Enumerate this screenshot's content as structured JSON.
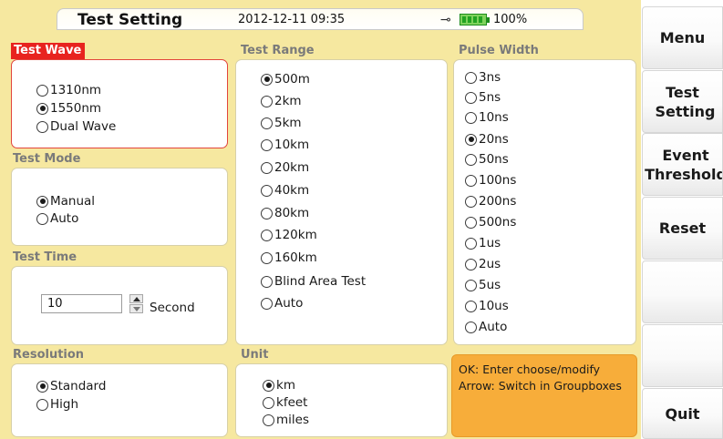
{
  "header": {
    "title": "Test Setting",
    "datetime": "2012-12-11 09:35",
    "battery_percent": "100%",
    "icons": [
      "power-plug-icon",
      "battery-icon"
    ]
  },
  "test_wave": {
    "title": "Test Wave",
    "active": true,
    "options": [
      {
        "label": "1310nm",
        "selected": false
      },
      {
        "label": "1550nm",
        "selected": true
      },
      {
        "label": "Dual Wave",
        "selected": false
      }
    ]
  },
  "test_mode": {
    "title": "Test Mode",
    "options": [
      {
        "label": "Manual",
        "selected": true
      },
      {
        "label": "Auto",
        "selected": false
      }
    ]
  },
  "test_time": {
    "title": "Test Time",
    "value": "10",
    "unit": "Second"
  },
  "resolution": {
    "title": "Resolution",
    "options": [
      {
        "label": "Standard",
        "selected": true
      },
      {
        "label": "High",
        "selected": false
      }
    ]
  },
  "test_range": {
    "title": "Test Range",
    "options": [
      {
        "label": "500m",
        "selected": true
      },
      {
        "label": "2km",
        "selected": false
      },
      {
        "label": "5km",
        "selected": false
      },
      {
        "label": "10km",
        "selected": false
      },
      {
        "label": "20km",
        "selected": false
      },
      {
        "label": "40km",
        "selected": false
      },
      {
        "label": "80km",
        "selected": false
      },
      {
        "label": "120km",
        "selected": false
      },
      {
        "label": "160km",
        "selected": false
      },
      {
        "label": "Blind Area Test",
        "selected": false
      },
      {
        "label": "Auto",
        "selected": false
      }
    ]
  },
  "unit": {
    "title": "Unit",
    "options": [
      {
        "label": "km",
        "selected": true
      },
      {
        "label": "kfeet",
        "selected": false
      },
      {
        "label": "miles",
        "selected": false
      }
    ]
  },
  "pulse_width": {
    "title": "Pulse Width",
    "options": [
      {
        "label": "3ns",
        "selected": false
      },
      {
        "label": "5ns",
        "selected": false
      },
      {
        "label": "10ns",
        "selected": false
      },
      {
        "label": "20ns",
        "selected": true
      },
      {
        "label": "50ns",
        "selected": false
      },
      {
        "label": "100ns",
        "selected": false
      },
      {
        "label": "200ns",
        "selected": false
      },
      {
        "label": "500ns",
        "selected": false
      },
      {
        "label": "1us",
        "selected": false
      },
      {
        "label": "2us",
        "selected": false
      },
      {
        "label": "5us",
        "selected": false
      },
      {
        "label": "10us",
        "selected": false
      },
      {
        "label": "Auto",
        "selected": false
      }
    ]
  },
  "help": {
    "line1": "OK: Enter choose/modify",
    "line2": "Arrow: Switch in Groupboxes"
  },
  "side_menu": {
    "menu": "Menu",
    "test_setting": "Test Setting",
    "event_threshold": "Event Threshold",
    "reset": "Reset",
    "quit": "Quit"
  },
  "colors": {
    "background": "#f6e8a0",
    "active_group": "#e8231f",
    "help_box": "#f7ad3a"
  }
}
